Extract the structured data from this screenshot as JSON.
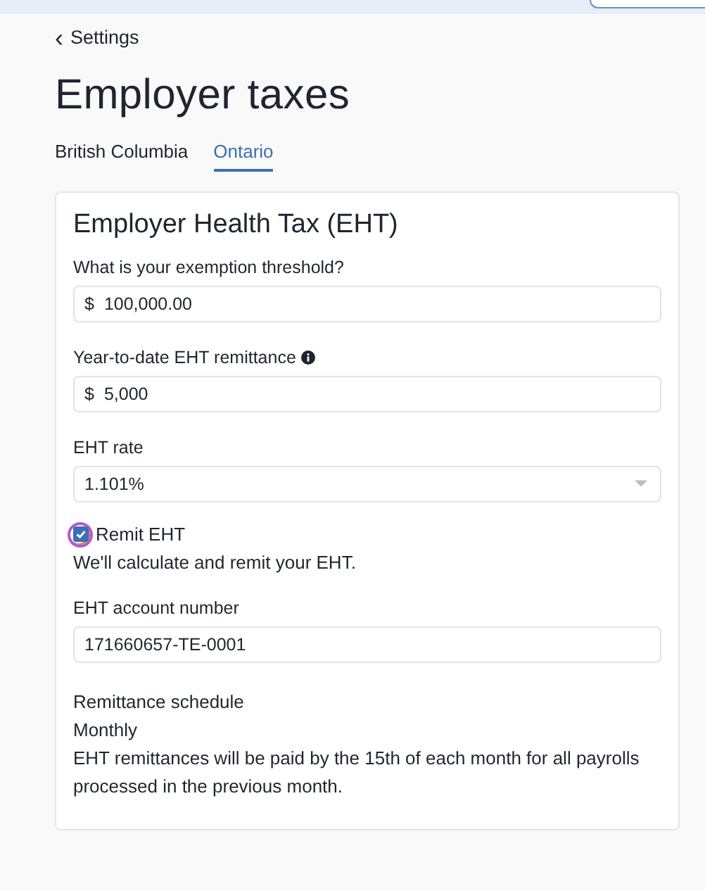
{
  "back_link": {
    "icon": "‹",
    "label": "Settings"
  },
  "title": "Employer taxes",
  "tabs": [
    {
      "label": "British Columbia",
      "selected": false
    },
    {
      "label": "Ontario",
      "selected": true
    }
  ],
  "card": {
    "heading": "Employer Health Tax (EHT)",
    "fields": [
      {
        "kind": "money",
        "label": "What is your exemption threshold?",
        "info": false,
        "prefix": "$",
        "value": "100,000.00"
      },
      {
        "kind": "money",
        "label": "Year-to-date EHT remittance",
        "info": true,
        "prefix": "$",
        "value": "5,000"
      },
      {
        "kind": "select",
        "label": "EHT rate",
        "value": "1.101%"
      },
      {
        "kind": "checkbox",
        "label": "Remit EHT",
        "checked": true,
        "focused": true,
        "description": "We'll calculate and remit your EHT."
      },
      {
        "kind": "text",
        "label": "EHT account number",
        "value": "171660657-TE-0001"
      }
    ],
    "schedule": {
      "label": "Remittance schedule",
      "value": "Monthly",
      "note": "EHT remittances will be paid by the 15th of each month for all payrolls processed in the previous month."
    }
  }
}
